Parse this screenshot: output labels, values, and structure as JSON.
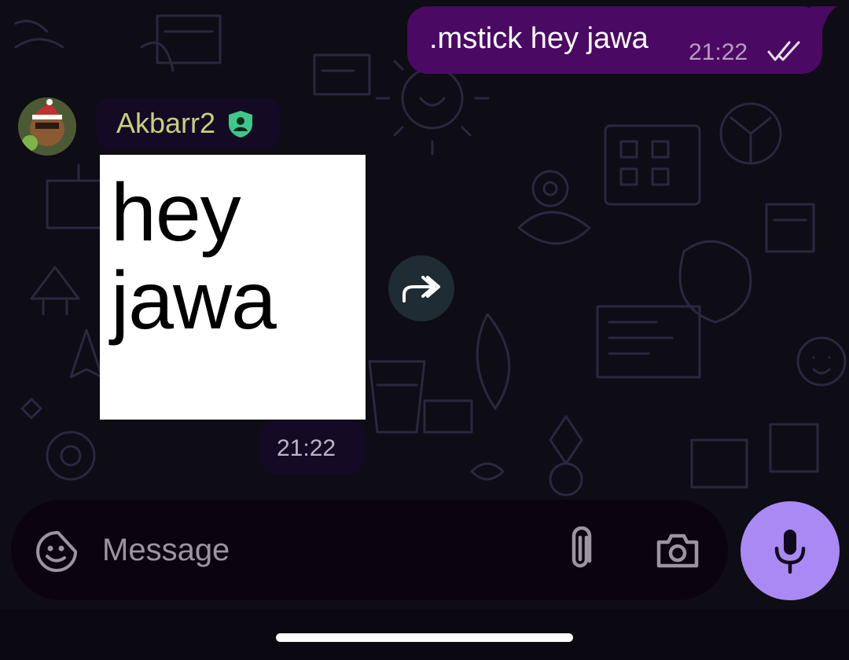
{
  "theme": {
    "outgoing_bubble": "#4a0a63",
    "incoming_pill": "#140a24",
    "sender_name_color": "#c7d07a",
    "admin_badge_color": "#3ec98a",
    "mic_button": "#a98af5",
    "background": "#0e0c14"
  },
  "outgoing_message": {
    "text": ".mstick hey jawa",
    "time": "21:22",
    "status_icon": "double-check-icon"
  },
  "incoming_message": {
    "sender_name": "Akbarr2",
    "sender_badge_icon": "admin-shield-icon",
    "sticker_lines": [
      "hey",
      "jawa"
    ],
    "time": "21:22",
    "forward_icon": "forward-icon"
  },
  "composer": {
    "placeholder": "Message",
    "emoji_icon": "sticker-emoji-icon",
    "attach_icon": "paperclip-icon",
    "camera_icon": "camera-icon",
    "mic_icon": "microphone-icon"
  }
}
